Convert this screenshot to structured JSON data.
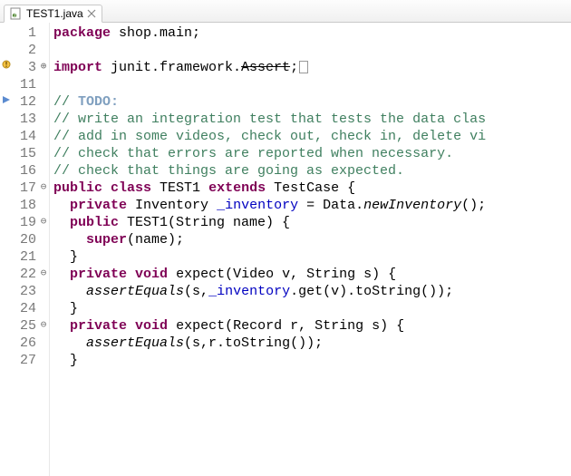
{
  "tab": {
    "filename": "TEST1.java"
  },
  "lines": [
    {
      "n": 1,
      "mark": "",
      "fold": "",
      "tokens": [
        [
          "kw",
          "package"
        ],
        [
          "",
          " shop.main;"
        ]
      ]
    },
    {
      "n": 2,
      "mark": "",
      "fold": "",
      "tokens": [
        [
          "",
          ""
        ]
      ]
    },
    {
      "n": 3,
      "mark": "warn",
      "fold": "plus",
      "tokens": [
        [
          "kw",
          "import"
        ],
        [
          "",
          " junit.framework."
        ],
        [
          "dep",
          "Assert"
        ],
        [
          "",
          ";"
        ],
        [
          "box",
          ""
        ]
      ]
    },
    {
      "n": 11,
      "mark": "",
      "fold": "",
      "tokens": [
        [
          "",
          ""
        ]
      ]
    },
    {
      "n": 12,
      "mark": "tri",
      "fold": "",
      "tokens": [
        [
          "cm",
          "// "
        ],
        [
          "todo",
          "TODO:"
        ]
      ]
    },
    {
      "n": 13,
      "mark": "",
      "fold": "",
      "tokens": [
        [
          "cm",
          "// write an integration test that tests the data clas"
        ]
      ]
    },
    {
      "n": 14,
      "mark": "",
      "fold": "",
      "tokens": [
        [
          "cm",
          "// add in some videos, check out, check in, delete vi"
        ]
      ]
    },
    {
      "n": 15,
      "mark": "",
      "fold": "",
      "tokens": [
        [
          "cm",
          "// check that errors are reported when necessary."
        ]
      ]
    },
    {
      "n": 16,
      "mark": "",
      "fold": "",
      "tokens": [
        [
          "cm",
          "// check that things are going as expected."
        ]
      ]
    },
    {
      "n": 17,
      "mark": "",
      "fold": "minus",
      "tokens": [
        [
          "kw",
          "public"
        ],
        [
          "",
          " "
        ],
        [
          "kw",
          "class"
        ],
        [
          "",
          " TEST1 "
        ],
        [
          "kw",
          "extends"
        ],
        [
          "",
          " TestCase {"
        ]
      ]
    },
    {
      "n": 18,
      "mark": "",
      "fold": "",
      "tokens": [
        [
          "",
          "  "
        ],
        [
          "kw",
          "private"
        ],
        [
          "",
          " Inventory "
        ],
        [
          "fld",
          "_inventory"
        ],
        [
          "",
          " = Data."
        ],
        [
          "mth",
          "newInventory"
        ],
        [
          "",
          "();"
        ]
      ]
    },
    {
      "n": 19,
      "mark": "",
      "fold": "minus",
      "tokens": [
        [
          "",
          "  "
        ],
        [
          "kw",
          "public"
        ],
        [
          "",
          " TEST1(String name) {"
        ]
      ]
    },
    {
      "n": 20,
      "mark": "",
      "fold": "",
      "tokens": [
        [
          "",
          "    "
        ],
        [
          "kw",
          "super"
        ],
        [
          "",
          "(name);"
        ]
      ]
    },
    {
      "n": 21,
      "mark": "",
      "fold": "",
      "tokens": [
        [
          "",
          "  }"
        ]
      ]
    },
    {
      "n": 22,
      "mark": "",
      "fold": "minus",
      "tokens": [
        [
          "",
          "  "
        ],
        [
          "kw",
          "private"
        ],
        [
          "",
          " "
        ],
        [
          "kw",
          "void"
        ],
        [
          "",
          " expect(Video v, String s) {"
        ]
      ]
    },
    {
      "n": 23,
      "mark": "",
      "fold": "",
      "tokens": [
        [
          "",
          "    "
        ],
        [
          "mth",
          "assertEquals"
        ],
        [
          "",
          "(s,"
        ],
        [
          "fld",
          "_inventory"
        ],
        [
          "",
          ".get(v).toString());"
        ]
      ]
    },
    {
      "n": 24,
      "mark": "",
      "fold": "",
      "tokens": [
        [
          "",
          "  }"
        ]
      ]
    },
    {
      "n": 25,
      "mark": "",
      "fold": "minus",
      "tokens": [
        [
          "",
          "  "
        ],
        [
          "kw",
          "private"
        ],
        [
          "",
          " "
        ],
        [
          "kw",
          "void"
        ],
        [
          "",
          " expect(Record r, String s) {"
        ]
      ]
    },
    {
      "n": 26,
      "mark": "",
      "fold": "",
      "tokens": [
        [
          "",
          "    "
        ],
        [
          "mth",
          "assertEquals"
        ],
        [
          "",
          "(s,r.toString());"
        ]
      ]
    },
    {
      "n": 27,
      "mark": "",
      "fold": "",
      "tokens": [
        [
          "",
          "  }"
        ]
      ]
    }
  ]
}
